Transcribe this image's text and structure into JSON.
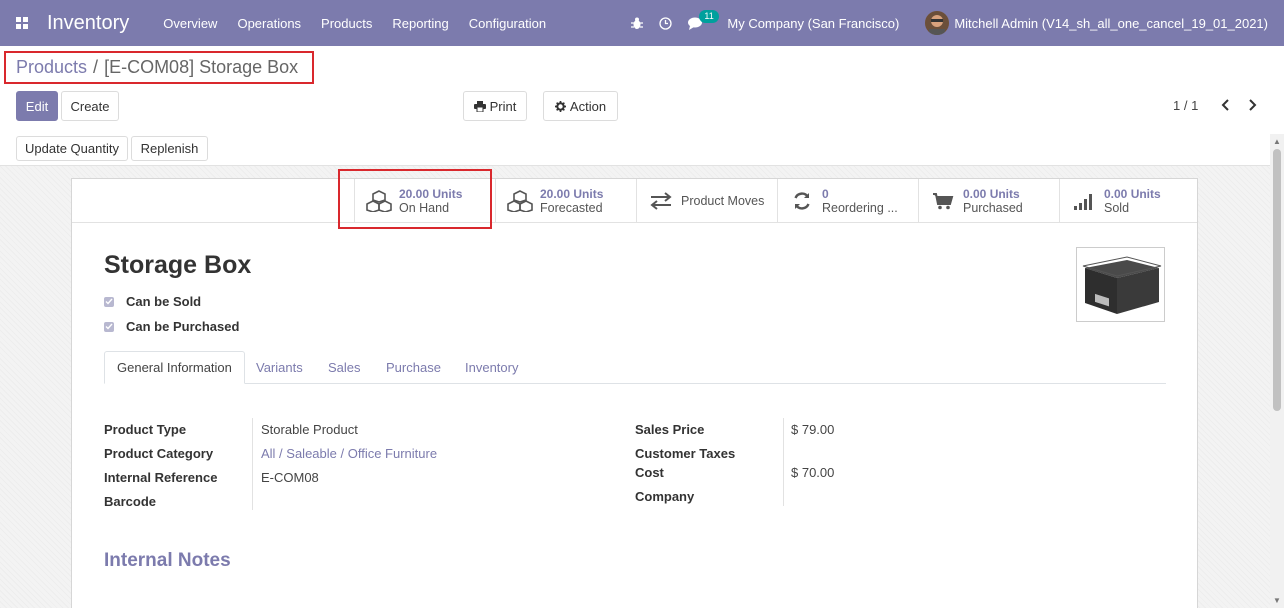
{
  "navbar": {
    "app_title": "Inventory",
    "menu": [
      "Overview",
      "Operations",
      "Products",
      "Reporting",
      "Configuration"
    ],
    "chat_count": "11",
    "company": "My Company (San Francisco)",
    "user": "Mitchell Admin (V14_sh_all_one_cancel_19_01_2021)",
    "color": "#7c7bad"
  },
  "breadcrumb": {
    "parent": "Products",
    "separator": "/",
    "current": "[E-COM08] Storage Box"
  },
  "control": {
    "edit": "Edit",
    "create": "Create",
    "print": "Print",
    "action": "Action",
    "pager": "1 / 1",
    "update_qty": "Update Quantity",
    "replenish": "Replenish"
  },
  "stats": {
    "on_hand": {
      "value": "20.00 Units",
      "label": "On Hand"
    },
    "forecasted": {
      "value": "20.00 Units",
      "label": "Forecasted"
    },
    "moves": {
      "label": "Product Moves"
    },
    "reordering": {
      "value": "0",
      "label": "Reordering ..."
    },
    "purchased": {
      "value": "0.00 Units",
      "label": "Purchased"
    },
    "sold": {
      "value": "0.00 Units",
      "label": "Sold"
    }
  },
  "product": {
    "name": "Storage Box",
    "can_be_sold": "Can be Sold",
    "can_be_purchased": "Can be Purchased"
  },
  "tabs": [
    "General Information",
    "Variants",
    "Sales",
    "Purchase",
    "Inventory"
  ],
  "fields_left": {
    "type_label": "Product Type",
    "type_value": "Storable Product",
    "category_label": "Product Category",
    "category_value": "All / Saleable / Office Furniture",
    "ref_label": "Internal Reference",
    "ref_value": "E-COM08",
    "barcode_label": "Barcode"
  },
  "fields_right": {
    "price_label": "Sales Price",
    "price_value": "$ 79.00",
    "taxes_label": "Customer Taxes",
    "cost_label": "Cost",
    "cost_value": "$ 70.00",
    "company_label": "Company"
  },
  "notes_title": "Internal Notes"
}
